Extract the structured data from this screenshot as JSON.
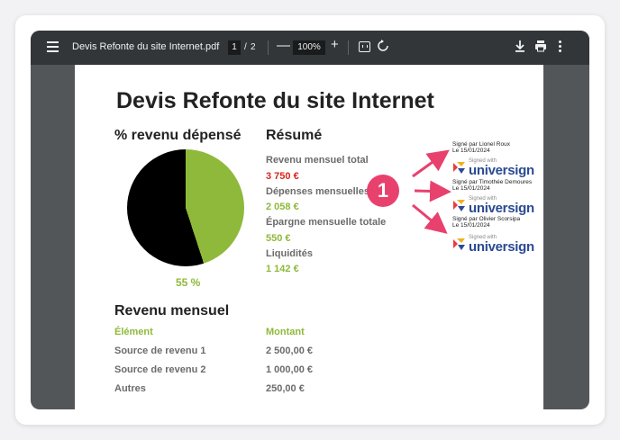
{
  "viewer": {
    "file_name": "Devis Refonte du site Internet.pdf",
    "current_page": "1",
    "page_separator": "/",
    "total_pages": "2",
    "zoom": "100%",
    "zoom_out_symbol": "—",
    "zoom_in_symbol": "+"
  },
  "document": {
    "title": "Devis Refonte du site Internet",
    "pie_section_title": "% revenu dépensé",
    "pie_percentage": "55 %",
    "summary_title": "Résumé",
    "summary": [
      {
        "label": "Revenu mensuel total",
        "value": "3 750 €",
        "color": "#d9261c"
      },
      {
        "label": "Dépenses mensuelles",
        "value": "2 058 €",
        "color": "#8fb93a"
      },
      {
        "label": "Épargne mensuelle totale",
        "value": "550 €",
        "color": "#8fb93a"
      },
      {
        "label": "Liquidités",
        "value": "1 142 €",
        "color": "#8fb93a"
      }
    ],
    "income_title": "Revenu mensuel",
    "income_table": {
      "headers": [
        "Élément",
        "Montant"
      ],
      "rows": [
        [
          "Source de revenu 1",
          "2 500,00 €"
        ],
        [
          "Source de revenu 2",
          "1 000,00 €"
        ],
        [
          "Autres",
          "250,00 €"
        ]
      ]
    }
  },
  "pie_chart": {
    "spent_fraction": 0.55,
    "colors": {
      "spent": "#000000",
      "remaining": "#8fb93a"
    }
  },
  "callout": {
    "number": "1",
    "color": "#e8416d"
  },
  "signatures": [
    {
      "signed_by": "Signé par Lionel Roux",
      "date": "Le 15/01/2024",
      "signed_with": "Signed with",
      "brand": "universign"
    },
    {
      "signed_by": "Signé par Timothée Demoures",
      "date": "Le 15/01/2024",
      "signed_with": "Signed with",
      "brand": "universign"
    },
    {
      "signed_by": "Signé par Olivier Scorsipa",
      "date": "Le 15/01/2024",
      "signed_with": "Signed with",
      "brand": "universign"
    }
  ],
  "icons": [
    "menu-icon",
    "rotate-icon",
    "fit-page-icon",
    "download-icon",
    "print-icon",
    "more-vert-icon"
  ]
}
